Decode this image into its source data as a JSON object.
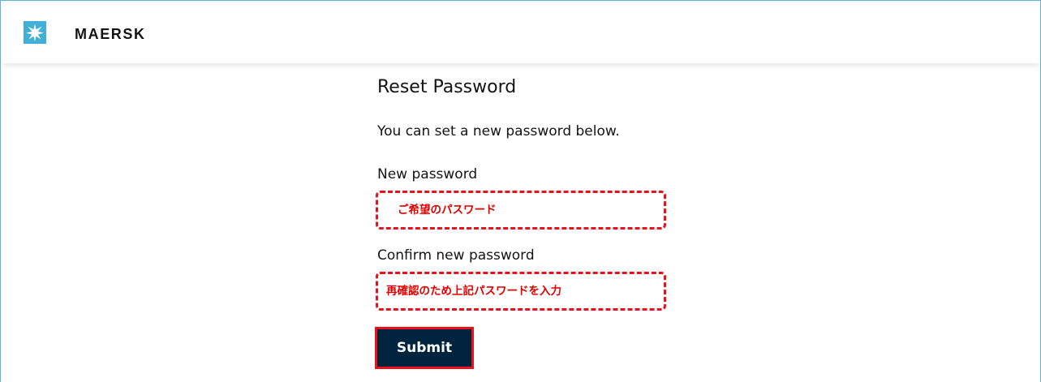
{
  "header": {
    "brand": "MAERSK",
    "logo_icon": "maersk-star-icon",
    "logo_color": "#42b0d5"
  },
  "form": {
    "title": "Reset Password",
    "description": "You can set a new password below.",
    "new_password_label": "New password",
    "new_password_placeholder": "ご希望のパスワード",
    "confirm_label": "Confirm new password",
    "confirm_placeholder": "再確認のため上記パスワードを入力",
    "submit_label": "Submit",
    "accent_color": "#e8121c",
    "button_color": "#00243d"
  }
}
